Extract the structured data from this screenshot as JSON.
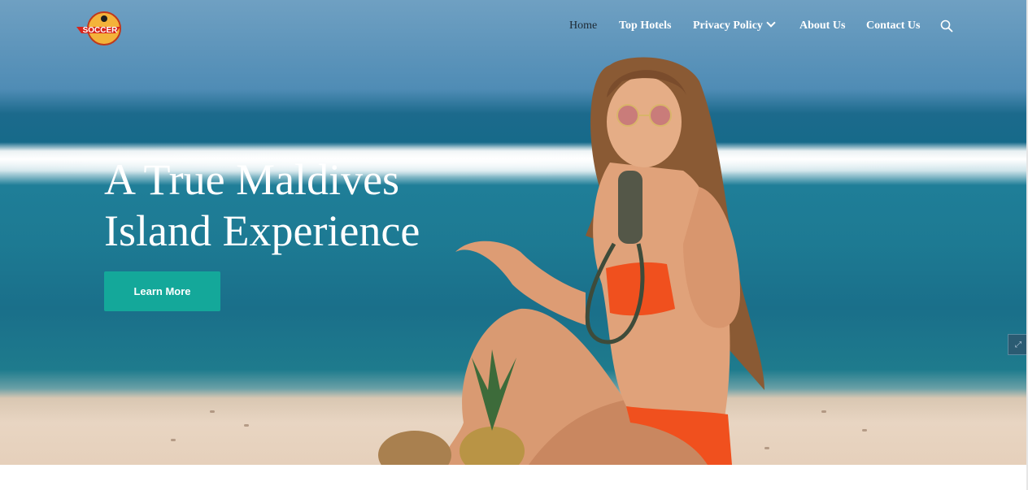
{
  "header": {
    "logo_icon": "soccer-logo",
    "nav": [
      {
        "label": "Home",
        "active": true
      },
      {
        "label": "Top Hotels",
        "active": false
      },
      {
        "label": "Privacy Policy",
        "active": false,
        "dropdown": true
      },
      {
        "label": "About Us",
        "active": false
      },
      {
        "label": "Contact Us",
        "active": false
      }
    ],
    "search_icon": "search-icon"
  },
  "hero": {
    "headline_line1": "A True Maldives",
    "headline_line2": "Island Experience",
    "cta_label": "Learn More",
    "cta_color": "#14a89a"
  },
  "side_widget": {
    "icon": "expand-icon"
  }
}
